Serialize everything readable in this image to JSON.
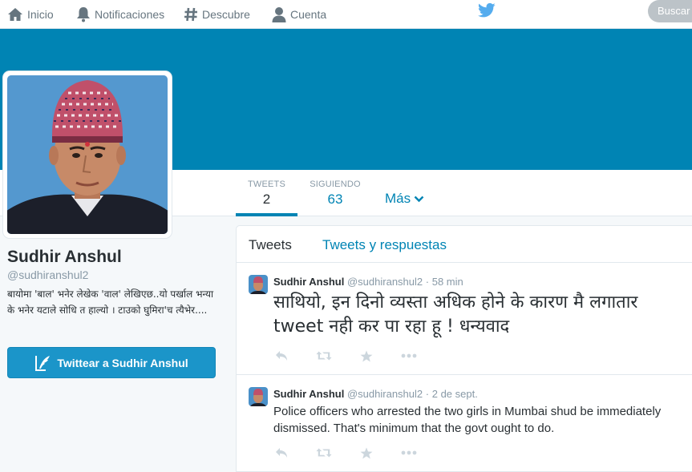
{
  "nav": {
    "home_label": "Inicio",
    "notifications_label": "Notificaciones",
    "discover_label": "Descubre",
    "account_label": "Cuenta",
    "search_placeholder": "Buscar e"
  },
  "colors": {
    "header_blue": "#0084b4",
    "link_blue": "#0084b4",
    "button_blue": "#1b95c9"
  },
  "profile_nav": {
    "tweets_label": "TWEETS",
    "tweets_count": "2",
    "following_label": "SIGUIENDO",
    "following_count": "63",
    "more_label": "Más"
  },
  "profile": {
    "name": "Sudhir Anshul",
    "handle": "@sudhiranshul2",
    "bio": "बायोमा 'बाल' भनेर लेखेक 'वाल' लेखिएछ..यो पर्खाल भन्या के भनेर यटाले सोधि त हाल्यो । टाउको घुमिरा'च त्यैभेर....",
    "tweet_to_label": "Twittear a Sudhir Anshul"
  },
  "timeline": {
    "tab_tweets": "Tweets",
    "tab_replies": "Tweets y respuestas",
    "tweets": [
      {
        "name": "Sudhir Anshul",
        "handle": "@sudhiranshul2",
        "time": "58 min",
        "text": "साथियो, इन दिनो व्यस्ता अधिक होने के कारण मै लगातार tweet नही कर पा रहा हू ! धन्यवाद"
      },
      {
        "name": "Sudhir Anshul",
        "handle": "@sudhiranshul2",
        "time": "2 de sept.",
        "text": "Police officers who arrested the two girls in Mumbai shud be immediately dismissed. That's minimum that the govt ought to do."
      }
    ]
  }
}
